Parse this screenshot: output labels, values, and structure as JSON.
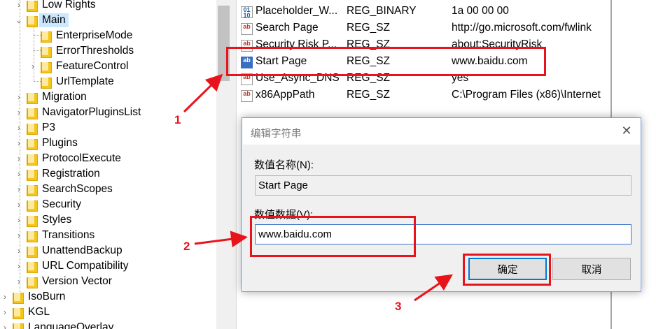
{
  "tree": {
    "items": [
      {
        "label": "Low Rights",
        "expander": ">"
      },
      {
        "label": "Main",
        "expander": "v"
      },
      {
        "label": "EnterpriseMode",
        "expander": ""
      },
      {
        "label": "ErrorThresholds",
        "expander": ""
      },
      {
        "label": "FeatureControl",
        "expander": ">"
      },
      {
        "label": "UrlTemplate",
        "expander": ""
      },
      {
        "label": "Migration",
        "expander": ">"
      },
      {
        "label": "NavigatorPluginsList",
        "expander": ">"
      },
      {
        "label": "P3",
        "expander": ">"
      },
      {
        "label": "Plugins",
        "expander": ">"
      },
      {
        "label": "ProtocolExecute",
        "expander": ">"
      },
      {
        "label": "Registration",
        "expander": ">"
      },
      {
        "label": "SearchScopes",
        "expander": ">"
      },
      {
        "label": "Security",
        "expander": ">"
      },
      {
        "label": "Styles",
        "expander": ">"
      },
      {
        "label": "Transitions",
        "expander": ">"
      },
      {
        "label": "UnattendBackup",
        "expander": ">"
      },
      {
        "label": "URL Compatibility",
        "expander": ">"
      },
      {
        "label": "Version Vector",
        "expander": ">"
      },
      {
        "label": "IsoBurn",
        "expander": ">"
      },
      {
        "label": "KGL",
        "expander": ">"
      },
      {
        "label": "LanguageOverlay",
        "expander": ">"
      }
    ]
  },
  "values": {
    "rows": [
      {
        "name": "Placeholder_W...",
        "type": "REG_BINARY",
        "data": "1a 00 00 00",
        "icon": "binary-value-icon"
      },
      {
        "name": "Search Page",
        "type": "REG_SZ",
        "data": "http://go.microsoft.com/fwlink",
        "icon": "string-value-icon"
      },
      {
        "name": "Security Risk P...",
        "type": "REG_SZ",
        "data": "about:SecurityRisk",
        "icon": "string-value-icon"
      },
      {
        "name": "Start Page",
        "type": "REG_SZ",
        "data": "www.baidu.com",
        "icon": "string-value-icon"
      },
      {
        "name": "Use_Async_DNS",
        "type": "REG_SZ",
        "data": "yes",
        "icon": "string-value-icon"
      },
      {
        "name": "x86AppPath",
        "type": "REG_SZ",
        "data": "C:\\Program Files (x86)\\Internet",
        "icon": "string-value-icon"
      }
    ]
  },
  "dialog": {
    "title": "编辑字符串",
    "name_label": "数值名称(N):",
    "name_value": "Start Page",
    "data_label": "数值数据(V):",
    "data_value": "www.baidu.com",
    "ok_label": "确定",
    "cancel_label": "取消",
    "close_glyph": "✕"
  },
  "annotations": {
    "step1": "1",
    "step2": "2",
    "step3": "3",
    "color": "#e8141c"
  },
  "colors": {
    "selection": "#cce8ff",
    "accent": "#0078d7",
    "folder": "#f5c518"
  }
}
